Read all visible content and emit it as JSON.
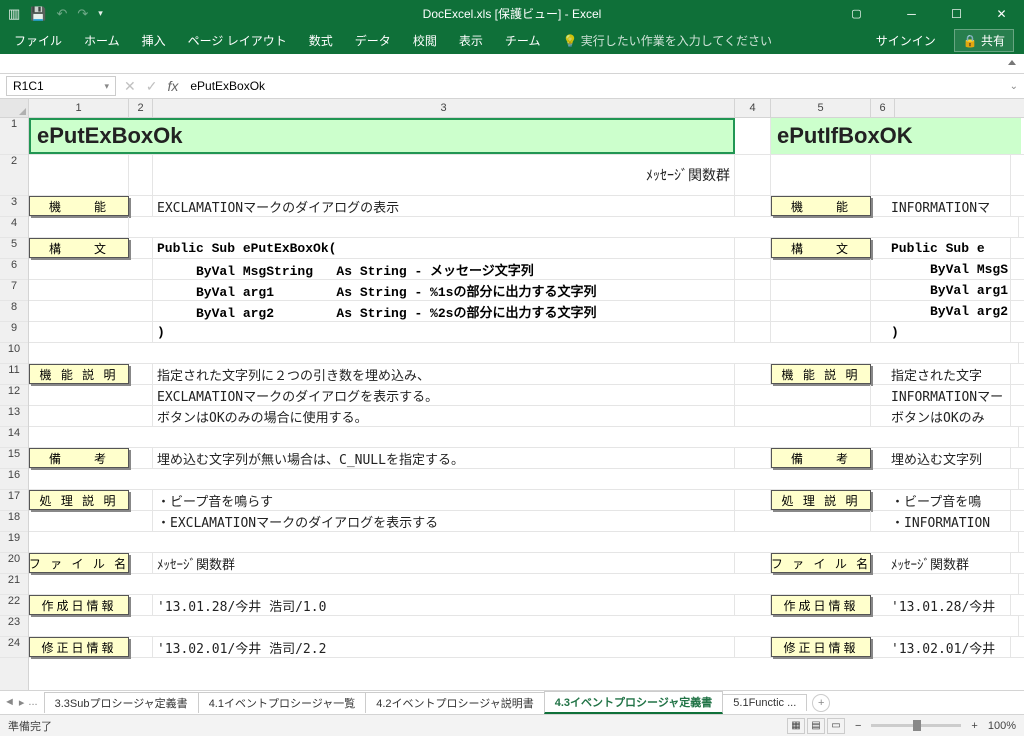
{
  "title": "DocExcel.xls [保護ビュー] - Excel",
  "qat": {
    "save": "💾",
    "undo": "↶",
    "redo": "↷",
    "custom": "▾"
  },
  "window": {
    "signin": "サインイン",
    "share": "🔒 共有"
  },
  "tabs": [
    "ファイル",
    "ホーム",
    "挿入",
    "ページ レイアウト",
    "数式",
    "データ",
    "校閲",
    "表示",
    "チーム"
  ],
  "tell_me": "実行したい作業を入力してください",
  "namebox": "R1C1",
  "formula": "ePutExBoxOk",
  "cols": {
    "c1": "1",
    "c2": "2",
    "c3": "3",
    "c4": "4",
    "c5": "5",
    "c6": "6"
  },
  "rows": [
    "1",
    "2",
    "3",
    "4",
    "5",
    "6",
    "7",
    "8",
    "9",
    "10",
    "11",
    "12",
    "13",
    "14",
    "15",
    "16",
    "17",
    "18",
    "19",
    "20",
    "21",
    "22",
    "23",
    "24"
  ],
  "cell": {
    "title1": "ePutExBoxOk",
    "title2": "ePutIfBoxOK",
    "subtitle": "ﾒｯｾｰｼﾞ関数群",
    "b_kinou": "機　　能",
    "b_koubun": "構　　文",
    "b_setsumei": "機 能 説 明",
    "b_bikou": "備　　考",
    "b_shori": "処 理 説 明",
    "b_file": "フ ァ イ ル 名",
    "b_sakusei": "作成日情報",
    "b_shusei": "修正日情報",
    "kinou1": "EXCLAMATIONマークのダイアログの表示",
    "kinou2": "INFORMATIONマ",
    "k1": "Public Sub ePutExBoxOk(",
    "k2": "Public Sub e",
    "k1a": "     ByVal MsgString   As String - メッセージ文字列",
    "k2a": "     ByVal MsgS",
    "k1b": "     ByVal arg1        As String - %1sの部分に出力する文字列",
    "k2b": "     ByVal arg1",
    "k1c": "     ByVal arg2        As String - %2sの部分に出力する文字列",
    "k2c": "     ByVal arg2",
    "k1d": ")",
    "k2d": ")",
    "s1": "指定された文字列に２つの引き数を埋め込み、",
    "s2": "指定された文字",
    "s1b": "EXCLAMATIONマークのダイアログを表示する。",
    "s2b": "INFORMATIONマー",
    "s1c": "ボタンはOKのみの場合に使用する。",
    "s2c": "ボタンはOKのみ",
    "bk1": "埋め込む文字列が無い場合は、C_NULLを指定する。",
    "bk2": "埋め込む文字列",
    "sh1": "・ビープ音を鳴らす",
    "sh2": "・ビープ音を鳴",
    "sh1b": "・EXCLAMATIONマークのダイアログを表示する",
    "sh2b": "・INFORMATION",
    "fn1": "ﾒｯｾｰｼﾞ関数群",
    "fn2": "ﾒｯｾｰｼﾞ関数群",
    "sk1": "'13.01.28/今井 浩司/1.0",
    "sk2": "'13.01.28/今井",
    "su1": "'13.02.01/今井 浩司/2.2",
    "su2": "'13.02.01/今井"
  },
  "sheets": {
    "nav_more": "...",
    "s1": "3.3Subプロシージャ定義書",
    "s2": "4.1イベントプロシージャ一覧",
    "s3": "4.2イベントプロシージャ説明書",
    "s4": "4.3イベントプロシージャ定義書",
    "s5": "5.1Functic",
    "s5b": "..."
  },
  "status": {
    "ready": "準備完了",
    "zoom": "100%",
    "minus": "−",
    "plus": "+"
  }
}
